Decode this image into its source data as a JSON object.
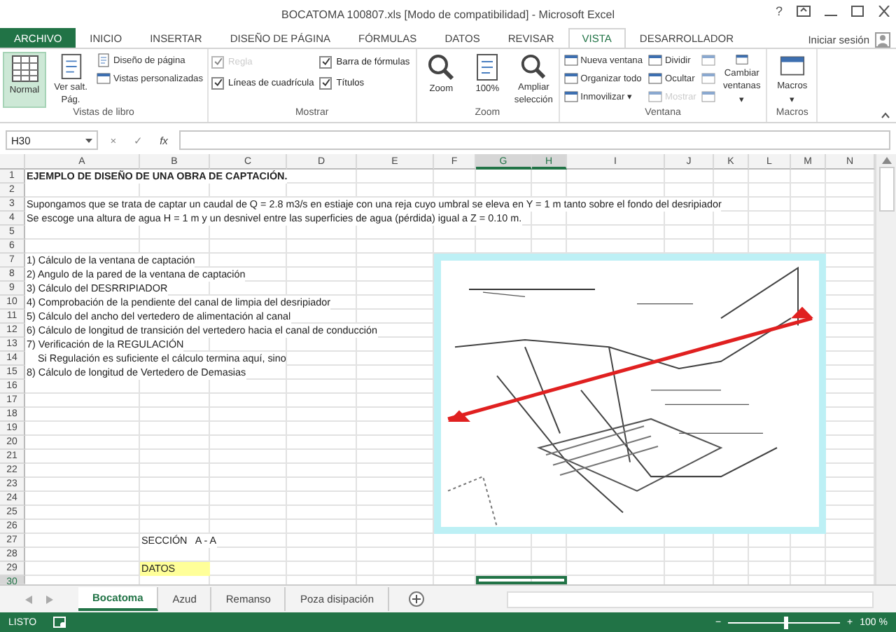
{
  "window": {
    "title": "BOCATOMA 100807.xls  [Modo de compatibilidad] - Microsoft Excel",
    "help": "?"
  },
  "ribbon_tabs": [
    {
      "label": "ARCHIVO",
      "selected": false
    },
    {
      "label": "INICIO",
      "selected": false
    },
    {
      "label": "INSERTAR",
      "selected": false
    },
    {
      "label": "DISEÑO DE PÁGINA",
      "selected": false
    },
    {
      "label": "FÓRMULAS",
      "selected": false
    },
    {
      "label": "DATOS",
      "selected": false
    },
    {
      "label": "REVISAR",
      "selected": false
    },
    {
      "label": "VISTA",
      "selected": true
    },
    {
      "label": "DESARROLLADOR",
      "selected": false
    }
  ],
  "account": {
    "label": "Iniciar sesión"
  },
  "ribbon_groups": [
    {
      "label": "Vistas de libro",
      "columns": [
        {
          "items": [
            {
              "kind": "large",
              "label": "Normal",
              "selected": true
            }
          ]
        },
        {
          "items": [
            {
              "kind": "large",
              "label": "Ver salt. Pág.",
              "selected": false
            }
          ]
        },
        {
          "items": [
            {
              "kind": "small",
              "label": "Diseño de página",
              "disabled": false
            },
            {
              "kind": "small",
              "label": "Vistas personalizadas",
              "disabled": false
            }
          ]
        }
      ]
    },
    {
      "label": "Mostrar",
      "columns": [
        {
          "items": [
            {
              "kind": "check",
              "label": "Regla",
              "checked": true,
              "disabled": true
            },
            {
              "kind": "check",
              "label": "Líneas de cuadrícula",
              "checked": true,
              "disabled": false
            }
          ]
        },
        {
          "items": [
            {
              "kind": "check",
              "label": "Barra de fórmulas",
              "checked": true,
              "disabled": false
            },
            {
              "kind": "check",
              "label": "Títulos",
              "checked": true,
              "disabled": false
            }
          ]
        }
      ]
    },
    {
      "label": "Zoom",
      "columns": [
        {
          "items": [
            {
              "kind": "large",
              "label": "Zoom"
            }
          ]
        },
        {
          "items": [
            {
              "kind": "large",
              "label": "100%"
            }
          ]
        },
        {
          "items": [
            {
              "kind": "large",
              "label": "Ampliar selección"
            }
          ]
        }
      ]
    },
    {
      "label": "Ventana",
      "columns": [
        {
          "items": [
            {
              "kind": "small",
              "label": "Nueva ventana",
              "disabled": false
            },
            {
              "kind": "small",
              "label": "Organizar todo",
              "disabled": false
            },
            {
              "kind": "small",
              "label": "Inmovilizar",
              "caret": "▾",
              "disabled": false
            }
          ]
        },
        {
          "items": [
            {
              "kind": "small",
              "label": "Dividir",
              "disabled": false
            },
            {
              "kind": "small",
              "label": "Ocultar",
              "disabled": false
            },
            {
              "kind": "small",
              "label": "Mostrar",
              "disabled": true
            }
          ]
        },
        {
          "items": [
            {
              "kind": "icon",
              "disabled": true
            },
            {
              "kind": "icon",
              "disabled": true
            },
            {
              "kind": "icon",
              "disabled": true
            }
          ]
        },
        {
          "items": [
            {
              "kind": "large",
              "label": "Cambiar ventanas",
              "caret": "▾"
            }
          ]
        }
      ]
    },
    {
      "label": "Macros",
      "columns": [
        {
          "items": [
            {
              "kind": "large",
              "label": "Macros",
              "caret": "▾"
            }
          ]
        }
      ]
    }
  ],
  "formula_bar": {
    "name_box": "H30",
    "buttons": [
      "×",
      "✓",
      "fx"
    ]
  },
  "columns": [
    {
      "label": "A",
      "selected": false
    },
    {
      "label": "B",
      "selected": false
    },
    {
      "label": "C",
      "selected": false
    },
    {
      "label": "D",
      "selected": false
    },
    {
      "label": "E",
      "selected": false
    },
    {
      "label": "F",
      "selected": false
    },
    {
      "label": "G",
      "selected": true
    },
    {
      "label": "H",
      "selected": true
    },
    {
      "label": "I",
      "selected": false
    },
    {
      "label": "J",
      "selected": false
    },
    {
      "label": "K",
      "selected": false
    },
    {
      "label": "L",
      "selected": false
    },
    {
      "label": "M",
      "selected": false
    },
    {
      "label": "N",
      "selected": false
    }
  ],
  "rows": [
    {
      "number": "1",
      "selected": false,
      "col_a": {
        "text": "EJEMPLO DE DISEÑO DE UNA OBRA DE CAPTACIÓN.",
        "bold": true
      }
    },
    {
      "number": "2",
      "selected": false
    },
    {
      "number": "3",
      "selected": false,
      "col_a": {
        "text": "Supongamos que se trata de captar un caudal de Q = 2.8 m3/s en estiaje con una reja cuyo umbral se eleva en Y = 1 m tanto sobre el fondo del desripiador"
      }
    },
    {
      "number": "4",
      "selected": false,
      "col_a": {
        "text": "Se escoge una altura de agua H = 1 m y un desnivel entre las superficies de agua (pérdida) igual a Z = 0.10 m."
      }
    },
    {
      "number": "5",
      "selected": false
    },
    {
      "number": "6",
      "selected": false
    },
    {
      "number": "7",
      "selected": false,
      "col_a": {
        "text": "1) Cálculo de la ventana de captación"
      }
    },
    {
      "number": "8",
      "selected": false,
      "col_a": {
        "text": "2) Angulo de la pared de la ventana de captación"
      }
    },
    {
      "number": "9",
      "selected": false,
      "col_a": {
        "text": "3) Cálculo del DESRRIPIADOR"
      }
    },
    {
      "number": "10",
      "selected": false,
      "col_a": {
        "text": "4) Comprobación de la pendiente del canal de limpia del desripiador"
      }
    },
    {
      "number": "11",
      "selected": false,
      "col_a": {
        "text": "5) Cálculo del ancho del vertedero de alimentación al canal"
      }
    },
    {
      "number": "12",
      "selected": false,
      "col_a": {
        "text": "6) Cálculo de longitud de transición del vertedero hacia el canal de conducción"
      }
    },
    {
      "number": "13",
      "selected": false,
      "col_a": {
        "text": "7) Verificación de la REGULACIÓN"
      }
    },
    {
      "number": "14",
      "selected": false,
      "col_a": {
        "text": "    Si Regulación es suficiente el cálculo termina aquí, sino"
      }
    },
    {
      "number": "15",
      "selected": false,
      "col_a": {
        "text": "8) Cálculo de longitud de Vertedero de Demasias"
      }
    },
    {
      "number": "16",
      "selected": false
    },
    {
      "number": "17",
      "selected": false
    },
    {
      "number": "18",
      "selected": false
    },
    {
      "number": "19",
      "selected": false
    },
    {
      "number": "20",
      "selected": false
    },
    {
      "number": "21",
      "selected": false
    },
    {
      "number": "22",
      "selected": false
    },
    {
      "number": "23",
      "selected": false
    },
    {
      "number": "24",
      "selected": false
    },
    {
      "number": "25",
      "selected": false
    },
    {
      "number": "26",
      "selected": false
    },
    {
      "number": "27",
      "selected": false,
      "col_b": {
        "text": "SECCIÓN   A - A"
      }
    },
    {
      "number": "28",
      "selected": false
    },
    {
      "number": "29",
      "selected": false,
      "col_b": {
        "text": "DATOS",
        "highlighted": true
      }
    },
    {
      "number": "30",
      "selected": true
    }
  ],
  "sheet_tabs": [
    {
      "label": "Bocatoma",
      "selected": true
    },
    {
      "label": "Azud",
      "selected": false
    },
    {
      "label": "Remanso",
      "selected": false
    },
    {
      "label": "Poza disipación",
      "selected": false
    }
  ],
  "status_bar": {
    "status": "LISTO",
    "zoom": {
      "minus": "−",
      "plus": "+",
      "level": 0.5,
      "reading": "100 %"
    }
  }
}
